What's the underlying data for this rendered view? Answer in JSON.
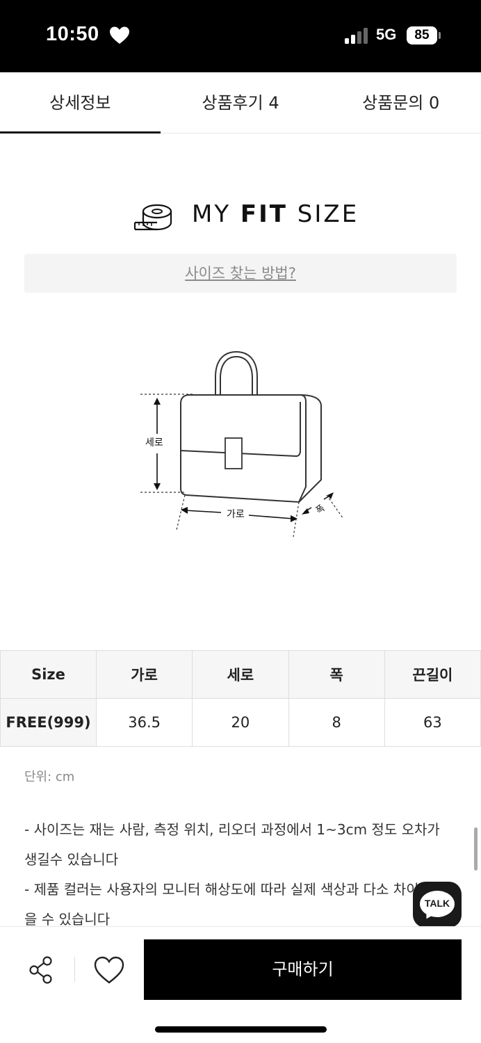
{
  "status_bar": {
    "time": "10:50",
    "network": "5G",
    "battery": "85"
  },
  "tabs": [
    {
      "label": "상세정보",
      "active": true
    },
    {
      "label": "상품후기 4",
      "active": false
    },
    {
      "label": "상품문의 0",
      "active": false
    }
  ],
  "fit_size": {
    "title_prefix": "MY ",
    "title_bold": "FIT",
    "title_suffix": " SIZE",
    "howto_link": "사이즈 찾는 방법?"
  },
  "diagram": {
    "height_label": "세로",
    "width_label": "가로",
    "depth_label": "폭"
  },
  "size_table": {
    "headers": [
      "Size",
      "가로",
      "세로",
      "폭",
      "끈길이"
    ],
    "rows": [
      [
        "FREE(999)",
        "36.5",
        "20",
        "8",
        "63"
      ]
    ]
  },
  "unit_note": "단위: cm",
  "notes": [
    "- 사이즈는 재는 사람, 측정 위치, 리오더 과정에서 1~3cm 정도 오차가 생길수 있습니다",
    "- 제품 컬러는 사용자의 모니터 해상도에 따라 실제 색상과 다소 차이가 있을 수 있습니다"
  ],
  "talk_button": "TALK",
  "buy_button": "구매하기"
}
